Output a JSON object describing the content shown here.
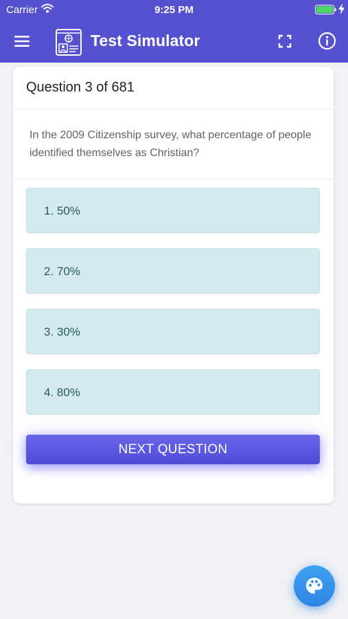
{
  "status_bar": {
    "carrier": "Carrier",
    "time": "9:25 PM",
    "icons": [
      "wifi-icon",
      "battery-icon",
      "charging-bolt-icon"
    ]
  },
  "nav": {
    "title": "Test Simulator",
    "icons": [
      "hamburger-menu-icon",
      "passport-id-logo-icon",
      "fullscreen-icon",
      "info-icon"
    ]
  },
  "quiz": {
    "question_counter": "Question 3 of 681",
    "question_text": "In the 2009 Citizenship survey, what percentage of people identified themselves as Christian?",
    "answers": [
      "1. 50%",
      "2. 70%",
      "3. 30%",
      "4. 80%"
    ],
    "next_label": "NEXT QUESTION"
  },
  "fab": {
    "icon": "palette-icon"
  },
  "colors": {
    "header": "#5651cf",
    "answer_bg": "#d3ebef",
    "answer_text": "#2b5860",
    "button": "#5a56e6",
    "fab": "#3392eb",
    "page_bg": "#f1f2f5"
  }
}
